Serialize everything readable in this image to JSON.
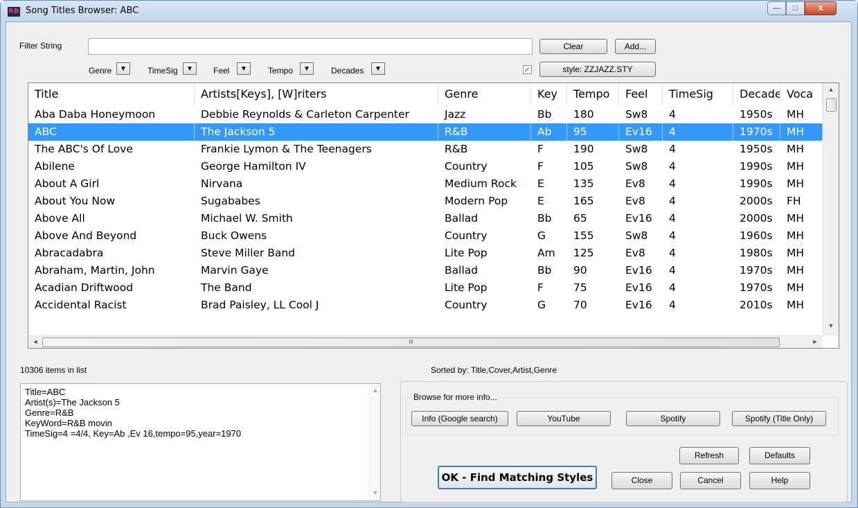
{
  "window": {
    "icon_text": "RB",
    "title": "Song Titles Browser: ABC",
    "controls": {
      "minimize": "—",
      "maximize": "□",
      "close": "X"
    }
  },
  "filter": {
    "label": "Filter String",
    "value": "",
    "clear_label": "Clear",
    "add_label": "Add...",
    "dropdown_glyph": "▼",
    "dropdowns": [
      "Genre",
      "TimeSig",
      "Feel",
      "Tempo",
      "Decades"
    ],
    "style_checked": true,
    "check_glyph": "✓",
    "style_label": "style: ZZJAZZ.STY"
  },
  "table": {
    "columns": [
      "Title",
      "Artists[Keys], [W]riters",
      "Genre",
      "Key",
      "Tempo",
      "Feel",
      "TimeSig",
      "Decade",
      "Voca"
    ],
    "selected_row": 1,
    "rows": [
      [
        "Aba Daba Honeymoon",
        "Debbie Reynolds & Carleton Carpenter",
        "Jazz",
        "Bb",
        "180",
        "Sw8",
        "4",
        "1950s",
        "MH"
      ],
      [
        "ABC",
        "The Jackson 5",
        "R&B",
        "Ab",
        "95",
        "Ev16",
        "4",
        "1970s",
        "MH"
      ],
      [
        "The ABC's Of Love",
        "Frankie Lymon & The Teenagers",
        "R&B",
        "F",
        "190",
        "Sw8",
        "4",
        "1950s",
        "MH"
      ],
      [
        "Abilene",
        "George Hamilton IV",
        "Country",
        "F",
        "105",
        "Sw8",
        "4",
        "1990s",
        "MH"
      ],
      [
        "About A Girl",
        "Nirvana",
        "Medium Rock",
        "E",
        "135",
        "Ev8",
        "4",
        "1990s",
        "MH"
      ],
      [
        "About You Now",
        "Sugababes",
        "Modern Pop",
        "E",
        "165",
        "Ev8",
        "4",
        "2000s",
        "FH"
      ],
      [
        "Above All",
        "Michael W. Smith",
        "Ballad",
        "Bb",
        "65",
        "Ev16",
        "4",
        "2000s",
        "MH"
      ],
      [
        "Above And Beyond",
        "Buck Owens",
        "Country",
        "G",
        "155",
        "Sw8",
        "4",
        "1960s",
        "MH"
      ],
      [
        "Abracadabra",
        "Steve Miller Band",
        "Lite Pop",
        "Am",
        "125",
        "Ev8",
        "4",
        "1980s",
        "MH"
      ],
      [
        "Abraham, Martin, John",
        "Marvin Gaye",
        "Ballad",
        "Bb",
        "90",
        "Ev16",
        "4",
        "1970s",
        "MH"
      ],
      [
        "Acadian Driftwood",
        "The Band",
        "Lite Pop",
        "F",
        "75",
        "Ev16",
        "4",
        "1970s",
        "MH"
      ],
      [
        "Accidental Racist",
        "Brad Paisley, LL Cool J",
        "Country",
        "G",
        "70",
        "Ev16",
        "4",
        "2010s",
        "MH"
      ]
    ],
    "scroll": {
      "up": "▲",
      "down": "▼",
      "left": "◄",
      "right": "►",
      "grip": "III"
    }
  },
  "status": {
    "count": "10306 items in list",
    "sorted_by": "Sorted by: Title,Cover,Artist,Genre"
  },
  "info_text": "Title=ABC\nArtist(s)=The Jackson 5\nGenre=R&B\nKeyWord=R&B movin\nTimeSig=4 =4/4, Key=Ab ,Ev 16,tempo=95,year=1970",
  "browse": {
    "label": "Browse for more info...",
    "buttons": [
      "Info (Google search)",
      "YouTube",
      "Spotify",
      "Spotify (Title Only)"
    ]
  },
  "actions": {
    "refresh": "Refresh",
    "defaults": "Defaults",
    "ok": "OK - Find Matching Styles",
    "close": "Close",
    "cancel": "Cancel",
    "help": "Help"
  },
  "colors": {
    "selection": "#3399ff",
    "window_frame": "#c5d8ec",
    "dialog_bg": "#f0f0f0"
  }
}
